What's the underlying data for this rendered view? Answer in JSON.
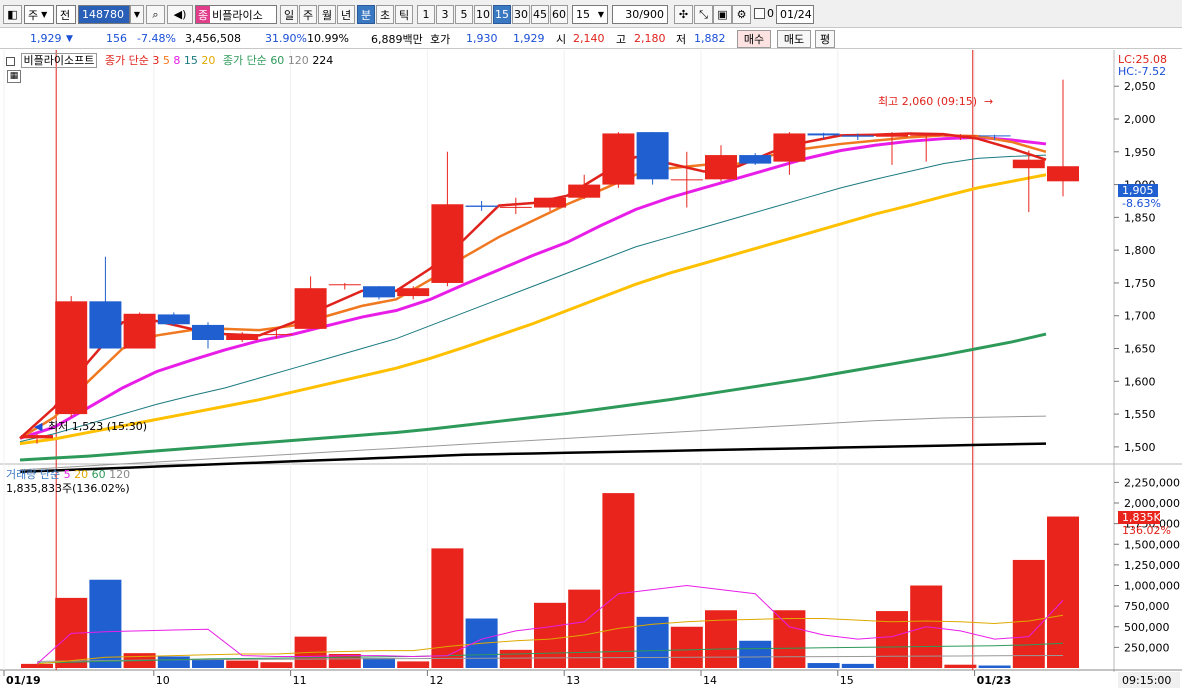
{
  "toolbar": {
    "market": "주",
    "prev": "전",
    "code": "148780",
    "name": "비플라이소",
    "name_tag": "종",
    "periods": [
      "일",
      "주",
      "월",
      "년",
      "분",
      "초",
      "틱"
    ],
    "intervals": [
      "1",
      "3",
      "5",
      "10",
      "15",
      "30",
      "45",
      "60"
    ],
    "interval_value": "15",
    "count": "30/900",
    "date": "01/24",
    "check_zero": "0"
  },
  "info": {
    "price": "1,929",
    "change": "156",
    "change_pct": "-7.48%",
    "volume": "3,456,508",
    "vol_ratio": "31.90%",
    "turnover": "10.99%",
    "amount": "6,889백만",
    "bid_label": "호가",
    "bid1": "1,930",
    "bid2": "1,929",
    "open_label": "시",
    "open": "2,140",
    "high_label": "고",
    "high": "2,180",
    "low_label": "저",
    "low": "1,882",
    "buy": "매수",
    "sell": "매도",
    "eval": "평"
  },
  "price_legend": {
    "title": "비플라이소프트",
    "ma_label": "종가 단순",
    "ma_periods": [
      "3",
      "5",
      "8",
      "15",
      "20"
    ],
    "ma2_label": "종가 단순",
    "ma2_periods": [
      "60",
      "120",
      "224"
    ]
  },
  "volume_legend": {
    "label": "거래량 단순",
    "periods": [
      "5",
      "20",
      "60",
      "120"
    ],
    "value": "1,835,833주(136.02%)"
  },
  "annotations": {
    "lc": "LC:25.08",
    "hc": "HC:-7.52",
    "high": "최고 2,060 (09:15)",
    "low": "최저 1,523 (15:30)",
    "last_price": "1,905",
    "last_pct": "-8.63%",
    "last_vol": "1,835K",
    "last_vol_pct": "136.02%",
    "time": "09:15:00"
  },
  "colors": {
    "up": "#e8241c",
    "down": "#1f5fd0",
    "ma3": "#e0221c",
    "ma5": "#f07820",
    "ma8": "#e81ee8",
    "ma15": "#1a7a80",
    "ma20": "#ffc000",
    "ma60": "#2e9a5a",
    "ma120": "#9a9a9a",
    "ma224": "#000000"
  },
  "chart_data": {
    "type": "candlestick",
    "price_axis": {
      "ticks": [
        1500,
        1550,
        1600,
        1650,
        1700,
        1750,
        1800,
        1850,
        1900,
        1950,
        2000,
        2050
      ],
      "range": [
        1480,
        2090
      ]
    },
    "volume_axis": {
      "ticks": [
        250000,
        500000,
        750000,
        1000000,
        1250000,
        1500000,
        1750000,
        2000000,
        2250000
      ],
      "tick_labels": [
        "250,000",
        "500,000",
        "750,000",
        "1,000,000",
        "1,250,000",
        "1,500,000",
        "1,750,000",
        "2,000,000",
        "2,250,000"
      ],
      "range": [
        0,
        2400000
      ]
    },
    "x_labels": [
      "01/19",
      "10",
      "11",
      "12",
      "13",
      "14",
      "15",
      "01/23"
    ],
    "candles": [
      {
        "o": 1513,
        "h": 1520,
        "l": 1505,
        "c": 1518,
        "v": 50000
      },
      {
        "o": 1550,
        "h": 1730,
        "l": 1545,
        "c": 1722,
        "v": 850000
      },
      {
        "o": 1722,
        "h": 1790,
        "l": 1650,
        "c": 1650,
        "v": 1070000
      },
      {
        "o": 1650,
        "h": 1705,
        "l": 1650,
        "c": 1703,
        "v": 180000
      },
      {
        "o": 1702,
        "h": 1705,
        "l": 1685,
        "c": 1687,
        "v": 140000
      },
      {
        "o": 1686,
        "h": 1690,
        "l": 1650,
        "c": 1663,
        "v": 110000
      },
      {
        "o": 1663,
        "h": 1675,
        "l": 1660,
        "c": 1672,
        "v": 90000
      },
      {
        "o": 1672,
        "h": 1680,
        "l": 1665,
        "c": 1672,
        "v": 70000
      },
      {
        "o": 1680,
        "h": 1760,
        "l": 1680,
        "c": 1742,
        "v": 380000
      },
      {
        "o": 1748,
        "h": 1750,
        "l": 1740,
        "c": 1748,
        "v": 170000
      },
      {
        "o": 1745,
        "h": 1745,
        "l": 1725,
        "c": 1728,
        "v": 120000
      },
      {
        "o": 1730,
        "h": 1745,
        "l": 1725,
        "c": 1742,
        "v": 80000
      },
      {
        "o": 1750,
        "h": 1950,
        "l": 1745,
        "c": 1870,
        "v": 1450000
      },
      {
        "o": 1868,
        "h": 1875,
        "l": 1860,
        "c": 1866,
        "v": 600000
      },
      {
        "o": 1866,
        "h": 1880,
        "l": 1855,
        "c": 1866,
        "v": 220000
      },
      {
        "o": 1865,
        "h": 1880,
        "l": 1860,
        "c": 1880,
        "v": 790000
      },
      {
        "o": 1880,
        "h": 1915,
        "l": 1878,
        "c": 1900,
        "v": 950000
      },
      {
        "o": 1900,
        "h": 1980,
        "l": 1895,
        "c": 1978,
        "v": 2120000
      },
      {
        "o": 1980,
        "h": 1980,
        "l": 1900,
        "c": 1908,
        "v": 620000
      },
      {
        "o": 1908,
        "h": 1950,
        "l": 1865,
        "c": 1908,
        "v": 500000
      },
      {
        "o": 1908,
        "h": 1960,
        "l": 1905,
        "c": 1945,
        "v": 700000
      },
      {
        "o": 1945,
        "h": 1948,
        "l": 1930,
        "c": 1932,
        "v": 330000
      },
      {
        "o": 1935,
        "h": 1980,
        "l": 1915,
        "c": 1978,
        "v": 700000
      },
      {
        "o": 1978,
        "h": 1979,
        "l": 1970,
        "c": 1975,
        "v": 60000
      },
      {
        "o": 1975,
        "h": 1978,
        "l": 1968,
        "c": 1973,
        "v": 50000
      },
      {
        "o": 1973,
        "h": 1980,
        "l": 1930,
        "c": 1978,
        "v": 690000
      },
      {
        "o": 1975,
        "h": 1978,
        "l": 1935,
        "c": 1976,
        "v": 1000000
      },
      {
        "o": 1975,
        "h": 1977,
        "l": 1968,
        "c": 1975,
        "v": 40000
      },
      {
        "o": 1975,
        "h": 1976,
        "l": 1968,
        "c": 1974,
        "v": 30000
      },
      {
        "o": 1925,
        "h": 1952,
        "l": 1858,
        "c": 1938,
        "v": 1310000
      },
      {
        "o": 1905,
        "h": 2060,
        "l": 1882,
        "c": 1928,
        "v": 1836000
      }
    ],
    "ma": {
      "ma3": [
        1513,
        1560,
        1630,
        1690,
        1692,
        1680,
        1672,
        1670,
        1690,
        1715,
        1738,
        1738,
        1772,
        1817,
        1868,
        1872,
        1883,
        1915,
        1942,
        1932,
        1920,
        1928,
        1950,
        1965,
        1975,
        1976,
        1978,
        1977,
        1970,
        1955,
        1938
      ],
      "ma5": [
        1513,
        1545,
        1600,
        1650,
        1670,
        1678,
        1680,
        1678,
        1685,
        1700,
        1715,
        1725,
        1755,
        1790,
        1820,
        1845,
        1870,
        1892,
        1915,
        1925,
        1930,
        1932,
        1945,
        1955,
        1962,
        1967,
        1972,
        1975,
        1974,
        1965,
        1950
      ],
      "ma8": [
        1513,
        1530,
        1560,
        1590,
        1615,
        1632,
        1648,
        1662,
        1672,
        1685,
        1698,
        1708,
        1725,
        1748,
        1770,
        1792,
        1812,
        1838,
        1862,
        1880,
        1895,
        1910,
        1925,
        1940,
        1952,
        1960,
        1966,
        1970,
        1972,
        1968,
        1962
      ],
      "ma15": [
        1508,
        1520,
        1535,
        1550,
        1565,
        1578,
        1590,
        1605,
        1620,
        1635,
        1650,
        1665,
        1685,
        1705,
        1725,
        1745,
        1765,
        1785,
        1805,
        1820,
        1835,
        1850,
        1865,
        1880,
        1895,
        1908,
        1920,
        1932,
        1940,
        1943,
        1945
      ],
      "ma20": [
        1505,
        1512,
        1522,
        1532,
        1542,
        1552,
        1562,
        1572,
        1584,
        1596,
        1608,
        1620,
        1635,
        1652,
        1670,
        1688,
        1708,
        1728,
        1748,
        1765,
        1780,
        1795,
        1810,
        1825,
        1840,
        1855,
        1868,
        1882,
        1895,
        1905,
        1915
      ],
      "ma60": [
        1480,
        1483,
        1486,
        1490,
        1494,
        1498,
        1502,
        1506,
        1510,
        1514,
        1518,
        1522,
        1527,
        1533,
        1539,
        1545,
        1551,
        1558,
        1565,
        1572,
        1580,
        1588,
        1596,
        1604,
        1613,
        1622,
        1631,
        1640,
        1650,
        1660,
        1672
      ],
      "ma120": [
        1465,
        1468,
        1471,
        1474,
        1477,
        1480,
        1483,
        1486,
        1489,
        1492,
        1495,
        1498,
        1501,
        1504,
        1507,
        1510,
        1513,
        1516,
        1519,
        1522,
        1525,
        1528,
        1531,
        1534,
        1537,
        1540,
        1542,
        1544,
        1545,
        1546,
        1547
      ],
      "ma224": [
        1462,
        1464,
        1466,
        1468,
        1470,
        1472,
        1474,
        1476,
        1478,
        1480,
        1482,
        1484,
        1486,
        1488,
        1489,
        1490,
        1491,
        1492,
        1493,
        1494,
        1495,
        1496,
        1497,
        1498,
        1499,
        1500,
        1501,
        1502,
        1503,
        1504,
        1505
      ],
      "vol5": [
        50000,
        420000,
        440000,
        450000,
        460000,
        470000,
        150000,
        140000,
        140000,
        150000,
        150000,
        140000,
        150000,
        350000,
        450000,
        500000,
        560000,
        900000,
        950000,
        1000000,
        950000,
        900000,
        500000,
        400000,
        350000,
        380000,
        500000,
        450000,
        350000,
        380000,
        820000
      ],
      "vol20": [
        50000,
        90000,
        130000,
        140000,
        150000,
        160000,
        170000,
        170000,
        190000,
        200000,
        210000,
        210000,
        260000,
        300000,
        330000,
        350000,
        400000,
        480000,
        530000,
        560000,
        580000,
        590000,
        600000,
        600000,
        580000,
        560000,
        570000,
        560000,
        540000,
        570000,
        640000
      ],
      "vol60": [
        60000,
        70000,
        80000,
        90000,
        100000,
        110000,
        115000,
        120000,
        125000,
        130000,
        135000,
        140000,
        150000,
        160000,
        170000,
        180000,
        190000,
        200000,
        210000,
        220000,
        230000,
        235000,
        240000,
        245000,
        250000,
        255000,
        260000,
        265000,
        270000,
        280000,
        300000
      ],
      "vol120": [
        80000,
        85000,
        90000,
        95000,
        100000,
        102000,
        104000,
        106000,
        108000,
        110000,
        112000,
        114000,
        116000,
        118000,
        120000,
        122000,
        124000,
        126000,
        128000,
        130000,
        132000,
        134000,
        136000,
        138000,
        140000,
        142000,
        144000,
        146000,
        148000,
        150000,
        152000
      ]
    }
  }
}
